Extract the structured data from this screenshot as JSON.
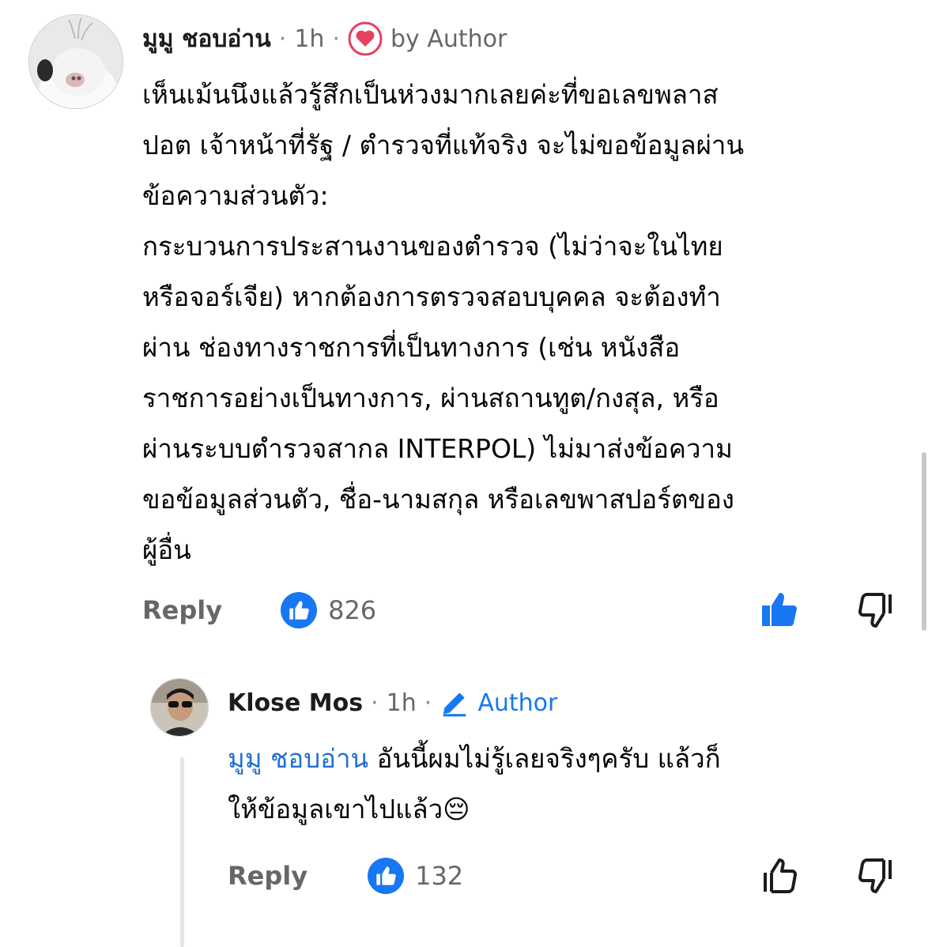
{
  "comments": [
    {
      "author": "มูมู ชอบอ่าน",
      "time": "1h",
      "badge": "by Author",
      "text": "เห็นเม้นนึงแล้วรู้สึกเป็นห่วงมากเลยค่ะที่ขอเลขพลาส\nปอต เจ้าหน้าที่รัฐ / ตำรวจที่แท้จริง จะไม่ขอข้อมูลผ่าน\nข้อความส่วนตัว:\nกระบวนการประสานงานของตำรวจ (ไม่ว่าจะในไทย\nหรือจอร์เจีย) หากต้องการตรวจสอบบุคคล จะต้องทำ\nผ่าน ช่องทางราชการที่เป็นทางการ (เช่น หนังสือ\nราชการอย่างเป็นทางการ, ผ่านสถานทูต/กงสุล, หรือ\nผ่านระบบตำรวจสากล INTERPOL) ไม่มาส่งข้อความ\nขอข้อมูลส่วนตัว, ชื่อ-นามสกุล หรือเลขพาสปอร์ตของ\nผู้อื่น",
      "reply_label": "Reply",
      "likes": "826",
      "heart_icon": "heart-icon",
      "upvote_icon": "thumb-up-filled-icon",
      "downvote_icon": "thumb-down-outline-icon"
    },
    {
      "author": "Klose Mos",
      "time": "1h",
      "badge": "Author",
      "mention": "มูมู ชอบอ่าน",
      "text_line1": " อันนี้ผมไม่รู้เลยจริงๆครับ แล้วก็",
      "text_line2": "ให้ข้อมูลเขาไปแล้ว😔",
      "reply_label": "Reply",
      "likes": "132",
      "pencil_icon": "pencil-icon",
      "upvote_icon": "thumb-up-outline-icon",
      "downvote_icon": "thumb-down-outline-icon"
    }
  ],
  "colors": {
    "accent": "#1877f2",
    "heart": "#e4405f",
    "muted": "#65676b"
  }
}
